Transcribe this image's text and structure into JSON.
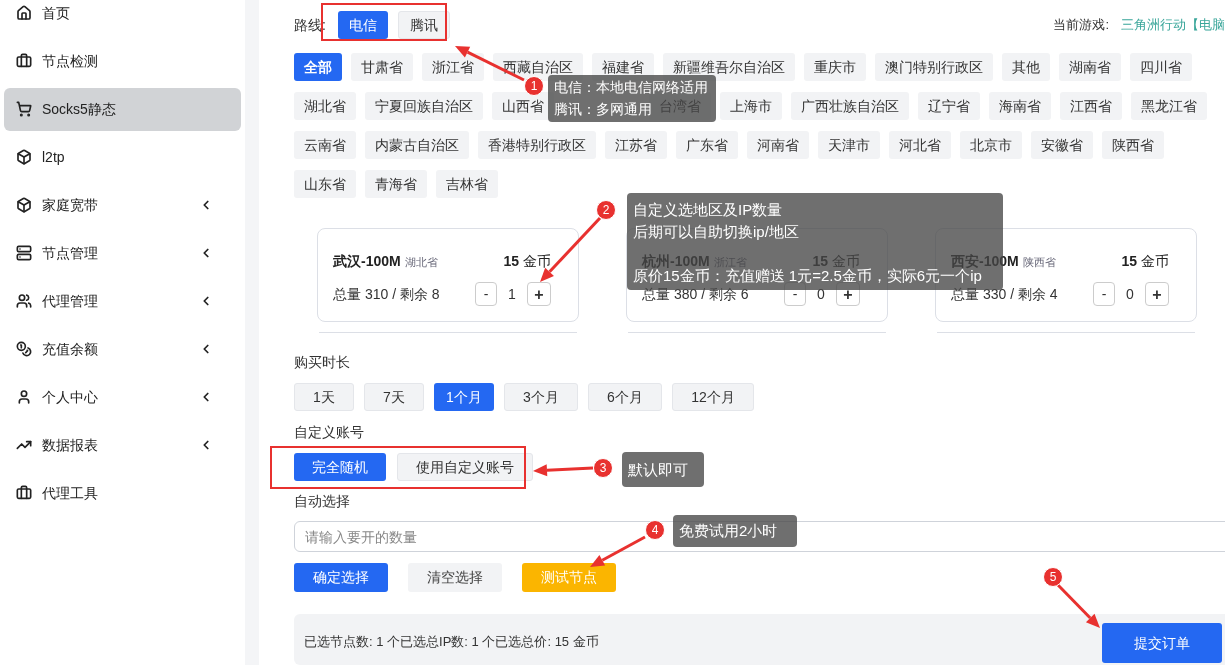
{
  "sidebar": {
    "items": [
      {
        "label": "首页",
        "selected": false,
        "expandable": false
      },
      {
        "label": "节点检测",
        "selected": false,
        "expandable": false
      },
      {
        "label": "Socks5静态",
        "selected": true,
        "expandable": false
      },
      {
        "label": "l2tp",
        "selected": false,
        "expandable": false
      },
      {
        "label": "家庭宽带",
        "selected": false,
        "expandable": true
      },
      {
        "label": "节点管理",
        "selected": false,
        "expandable": true
      },
      {
        "label": "代理管理",
        "selected": false,
        "expandable": true
      },
      {
        "label": "充值余额",
        "selected": false,
        "expandable": true
      },
      {
        "label": "个人中心",
        "selected": false,
        "expandable": true
      },
      {
        "label": "数据报表",
        "selected": false,
        "expandable": true
      },
      {
        "label": "代理工具",
        "selected": false,
        "expandable": false
      }
    ]
  },
  "route": {
    "label": "路线:",
    "options": [
      {
        "label": "电信",
        "selected": true
      },
      {
        "label": "腾讯",
        "selected": false
      }
    ]
  },
  "current_game": {
    "label": "当前游戏:",
    "value": "三角洲行动【电脑"
  },
  "regions": [
    {
      "label": "全部",
      "selected": true
    },
    {
      "label": "甘肃省",
      "selected": false
    },
    {
      "label": "浙江省",
      "selected": false
    },
    {
      "label": "西藏自治区",
      "selected": false
    },
    {
      "label": "福建省",
      "selected": false
    },
    {
      "label": "新疆维吾尔自治区",
      "selected": false
    },
    {
      "label": "重庆市",
      "selected": false
    },
    {
      "label": "澳门特别行政区",
      "selected": false
    },
    {
      "label": "其他",
      "selected": false
    },
    {
      "label": "湖南省",
      "selected": false
    },
    {
      "label": "四川省",
      "selected": false
    },
    {
      "label": "湖北省",
      "selected": false
    },
    {
      "label": "宁夏回族自治区",
      "selected": false
    },
    {
      "label": "山西省",
      "selected": false
    },
    {
      "label": "台湾省",
      "selected": false
    },
    {
      "label": "上海市",
      "selected": false
    },
    {
      "label": "广西壮族自治区",
      "selected": false
    },
    {
      "label": "辽宁省",
      "selected": false
    },
    {
      "label": "海南省",
      "selected": false
    },
    {
      "label": "江西省",
      "selected": false
    },
    {
      "label": "黑龙江省",
      "selected": false
    },
    {
      "label": "云南省",
      "selected": false
    },
    {
      "label": "内蒙古自治区",
      "selected": false
    },
    {
      "label": "香港特别行政区",
      "selected": false
    },
    {
      "label": "江苏省",
      "selected": false
    },
    {
      "label": "广东省",
      "selected": false
    },
    {
      "label": "河南省",
      "selected": false
    },
    {
      "label": "天津市",
      "selected": false
    },
    {
      "label": "河北省",
      "selected": false
    },
    {
      "label": "北京市",
      "selected": false
    },
    {
      "label": "安徽省",
      "selected": false
    },
    {
      "label": "陕西省",
      "selected": false
    },
    {
      "label": "山东省",
      "selected": false
    },
    {
      "label": "青海省",
      "selected": false
    },
    {
      "label": "吉林省",
      "selected": false
    }
  ],
  "nodes": [
    {
      "name": "武汉-100M",
      "province": "湖北省",
      "price": "**15** 金币",
      "stock": "总量 310 / 剩余 8",
      "decrement": "-",
      "quantity": "1",
      "increment": "+"
    },
    {
      "name": "杭州-100M",
      "province": "浙江省",
      "price": "**15** 金币",
      "stock": "总量 380 / 剩余 6",
      "decrement": "-",
      "quantity": "0",
      "increment": "+"
    },
    {
      "name": "西安-100M",
      "province": "陕西省",
      "price": "**15** 金币",
      "stock": "总量 330 / 剩余 4",
      "decrement": "-",
      "quantity": "0",
      "increment": "+"
    }
  ],
  "duration": {
    "label": "购买时长",
    "options": [
      {
        "label": "1天",
        "selected": false
      },
      {
        "label": "7天",
        "selected": false
      },
      {
        "label": "1个月",
        "selected": true
      },
      {
        "label": "3个月",
        "selected": false
      },
      {
        "label": "6个月",
        "selected": false
      },
      {
        "label": "12个月",
        "selected": false
      }
    ]
  },
  "account": {
    "label": "自定义账号",
    "options": [
      {
        "label": "完全随机",
        "selected": true
      },
      {
        "label": "使用自定义账号",
        "selected": false
      }
    ]
  },
  "auto_select": {
    "label": "自动选择",
    "placeholder": "请输入要开的数量"
  },
  "actions": [
    {
      "label": "确定选择",
      "kind": "primary"
    },
    {
      "label": "清空选择",
      "kind": "plain"
    },
    {
      "label": "测试节点",
      "kind": "warning"
    }
  ],
  "summary": {
    "text": "已选节点数: 1 个已选总IP数: 1 个已选总价: 15 金币",
    "submit": "提交订单"
  },
  "annotations": [
    {
      "number": "1",
      "lines": [
        "电信：本地电信网络适用",
        "腾讯：多网通用"
      ]
    },
    {
      "number": "2",
      "lines": [
        "自定义选地区及IP数量",
        "后期可以自助切换ip/地区",
        "原价15金币：充值赠送 1元=2.5金币，实际6元一个ip"
      ]
    },
    {
      "number": "3",
      "lines": [
        "默认即可"
      ]
    },
    {
      "number": "4",
      "lines": [
        "免费试用2小时"
      ]
    },
    {
      "number": "5"
    }
  ]
}
